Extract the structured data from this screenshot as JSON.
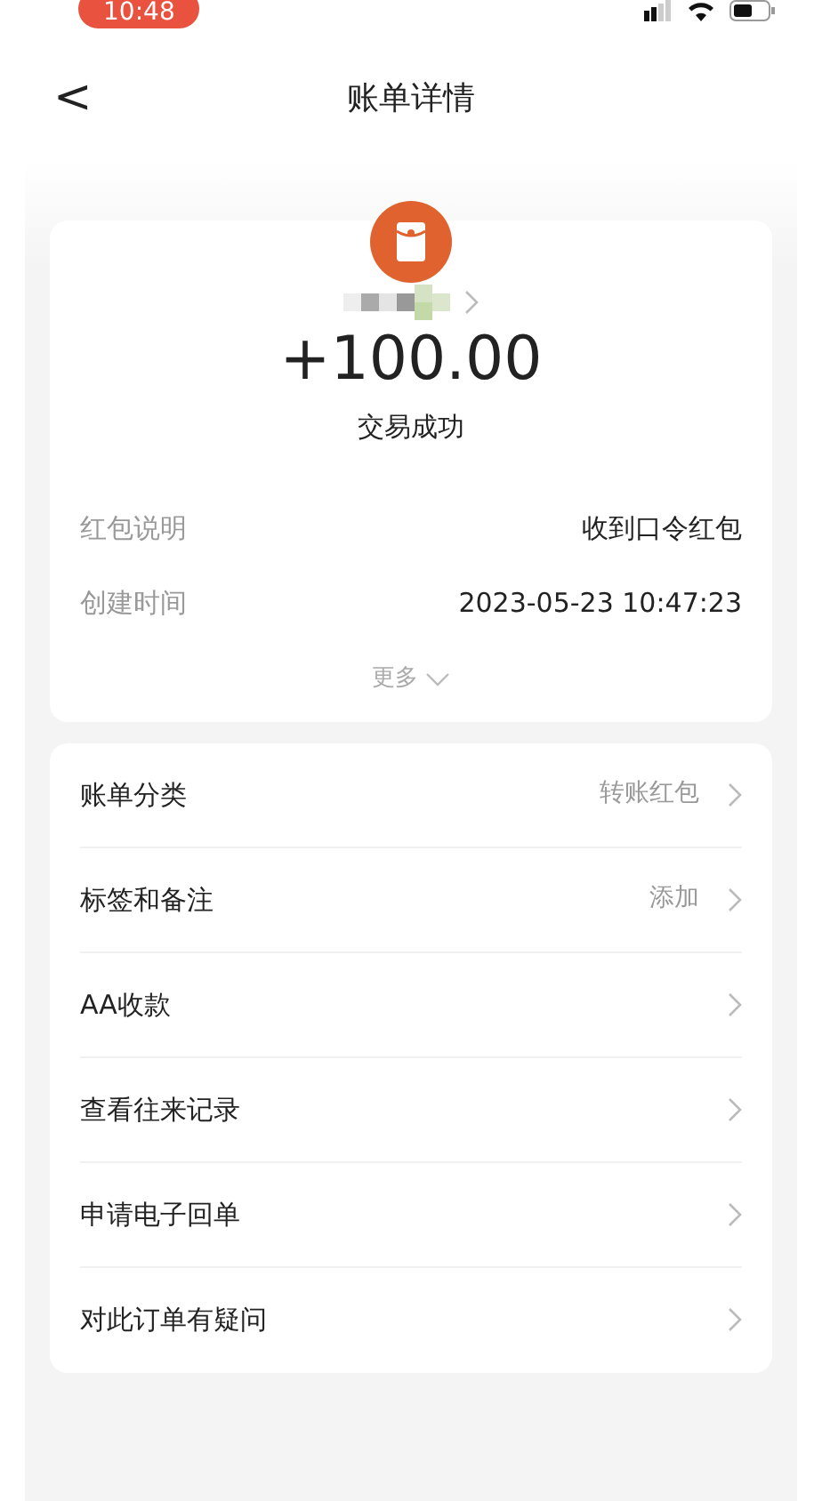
{
  "status_bar": {
    "time": "10:48"
  },
  "nav": {
    "back": "<",
    "title": "账单详情"
  },
  "summary": {
    "amount": "+100.00",
    "status": "交易成功",
    "details": [
      {
        "label": "红包说明",
        "value": "收到口令红包"
      },
      {
        "label": "创建时间",
        "value": "2023-05-23 10:47:23"
      }
    ],
    "more": "更多"
  },
  "menu": [
    {
      "label": "账单分类",
      "value": "转账红包"
    },
    {
      "label": "标签和备注",
      "value": "添加"
    },
    {
      "label": "AA收款"
    },
    {
      "label": "查看往来记录"
    },
    {
      "label": "申请电子回单"
    },
    {
      "label": "对此订单有疑问"
    }
  ]
}
